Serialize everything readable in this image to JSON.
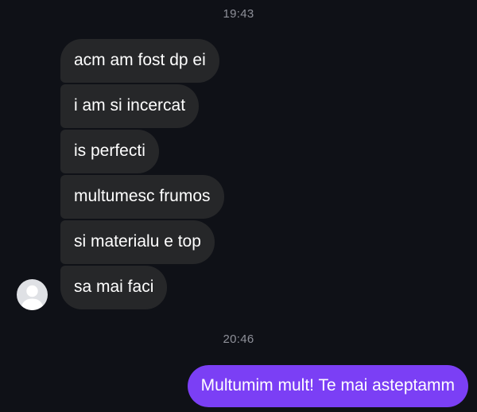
{
  "conversation": {
    "timestamps": [
      "19:43",
      "20:46"
    ],
    "incoming_messages": [
      "acm am fost dp ei",
      "i am si incercat",
      "is perfecti",
      "multumesc frumos",
      "si materialu e top",
      "sa mai faci"
    ],
    "outgoing_messages": [
      "Multumim mult! Te mai asteptamm"
    ]
  },
  "colors": {
    "background": "#0f1117",
    "incoming_bubble": "#262729",
    "outgoing_bubble": "#7b3ff5",
    "timestamp_text": "#8e9099"
  },
  "icons": {
    "avatar": "default-user-avatar-icon"
  }
}
